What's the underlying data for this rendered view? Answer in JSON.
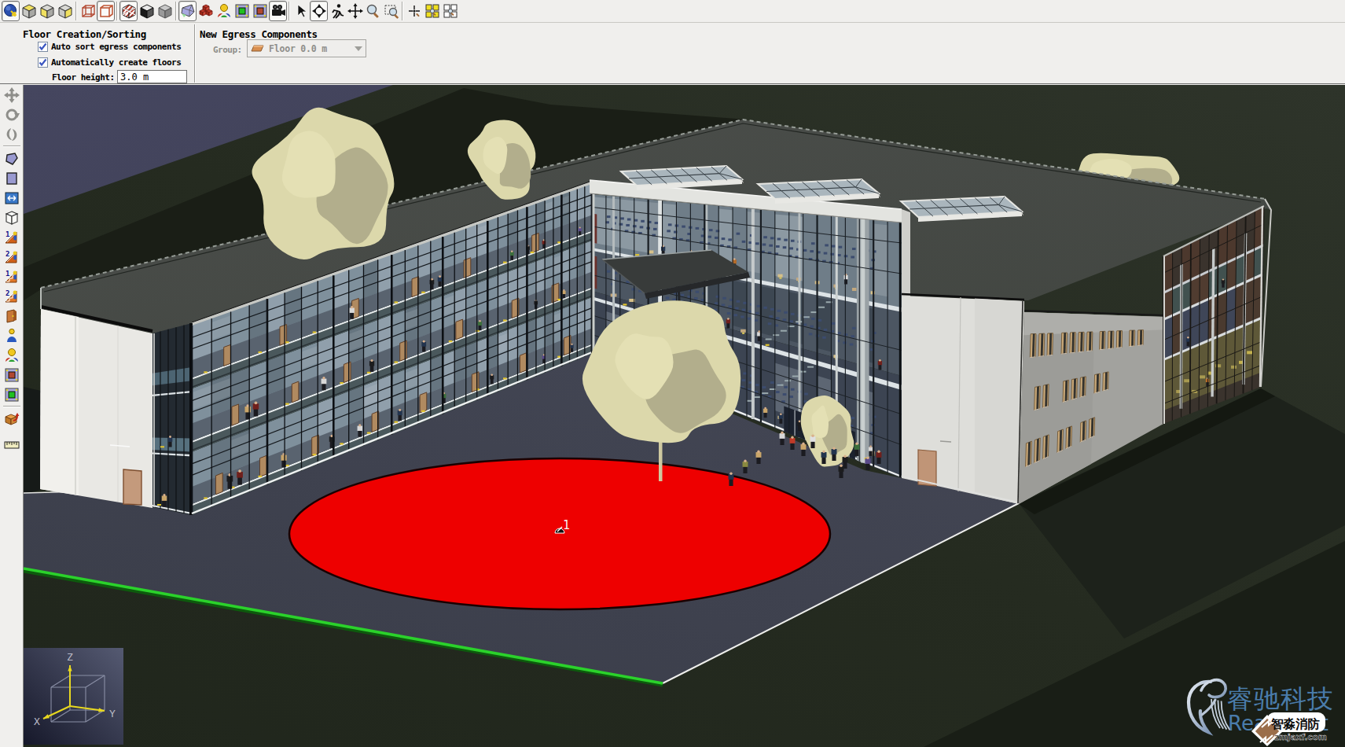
{
  "toolbar": {
    "buttons": [
      {
        "name": "select-objects",
        "icon": "sphere-select",
        "pressed": true
      },
      {
        "name": "select-faces-top",
        "icon": "cube-top",
        "pressed": false
      },
      {
        "name": "select-faces-side",
        "icon": "cube-side",
        "pressed": false
      },
      {
        "name": "select-faces-front",
        "icon": "cube-front",
        "pressed": false
      },
      {
        "name": "sep"
      },
      {
        "name": "wireframe-view",
        "icon": "wire-cube",
        "pressed": false
      },
      {
        "name": "wireframe-shaded-view",
        "icon": "wire-cube2",
        "pressed": true
      },
      {
        "name": "sep"
      },
      {
        "name": "show-construction",
        "icon": "hatch-cube",
        "pressed": true
      },
      {
        "name": "show-solid",
        "icon": "dark-cube",
        "pressed": false
      },
      {
        "name": "show-gray",
        "icon": "gray-cube",
        "pressed": false
      },
      {
        "name": "sep"
      },
      {
        "name": "show-terrain",
        "icon": "terrain",
        "pressed": true
      },
      {
        "name": "show-obstructions",
        "icon": "red-boxes",
        "pressed": false
      },
      {
        "name": "show-occupants",
        "icon": "people",
        "pressed": false
      },
      {
        "name": "show-rooms",
        "icon": "room-green",
        "pressed": false
      },
      {
        "name": "show-doors",
        "icon": "room-red",
        "pressed": false
      },
      {
        "name": "show-cameras",
        "icon": "camera",
        "pressed": true
      },
      {
        "name": "sep"
      },
      {
        "name": "select-tool",
        "icon": "cursor",
        "pressed": false
      },
      {
        "name": "orbit-tool",
        "icon": "orbit",
        "pressed": true
      },
      {
        "name": "walk-tool",
        "icon": "runner",
        "pressed": false
      },
      {
        "name": "pan-tool",
        "icon": "move",
        "pressed": false
      },
      {
        "name": "zoom-tool",
        "icon": "zoom",
        "pressed": false
      },
      {
        "name": "zoom-box-tool",
        "icon": "zoom-box",
        "pressed": false
      },
      {
        "name": "sep"
      },
      {
        "name": "zoom-to-point",
        "icon": "zoom-point",
        "pressed": false
      },
      {
        "name": "reset-view",
        "icon": "fit-yellow",
        "pressed": false
      },
      {
        "name": "fit-view",
        "icon": "fit-white",
        "pressed": false
      }
    ]
  },
  "ribbon": {
    "floor_panel": {
      "title": "Floor Creation/Sorting",
      "checkbox_auto_sort": {
        "label": "Auto sort egress components",
        "checked": true
      },
      "checkbox_auto_create": {
        "label": "Automatically create floors",
        "checked": true
      },
      "floor_height_label": "Floor height:",
      "floor_height_value": "3.0 m"
    },
    "egress_panel": {
      "title": "New Egress Components",
      "group_label": "Group:",
      "group_value": "Floor 0.0 m"
    }
  },
  "side_toolbar": {
    "buttons": [
      {
        "name": "pan-view",
        "icon": "pan-gray",
        "disabled": true
      },
      {
        "name": "orbit-view",
        "icon": "orbit-gray",
        "disabled": true
      },
      {
        "name": "roam-view",
        "icon": "roam-gray",
        "disabled": true
      },
      {
        "name": "sep"
      },
      {
        "name": "draw-polygon",
        "icon": "poly-tool"
      },
      {
        "name": "draw-rectangle",
        "icon": "rect-tool"
      },
      {
        "name": "measure-tool",
        "icon": "measure"
      },
      {
        "name": "draw-box",
        "icon": "box-tool"
      },
      {
        "name": "one-way-stair",
        "icon": "stair1"
      },
      {
        "name": "two-way-stair",
        "icon": "stair2"
      },
      {
        "name": "one-way-escalator",
        "icon": "stair1b"
      },
      {
        "name": "two-way-escalator",
        "icon": "stair2b"
      },
      {
        "name": "add-door",
        "icon": "door"
      },
      {
        "name": "add-occupant",
        "icon": "person"
      },
      {
        "name": "add-occupant-group",
        "icon": "people"
      },
      {
        "name": "add-room-door",
        "icon": "room-red"
      },
      {
        "name": "add-room",
        "icon": "room-green"
      },
      {
        "name": "sep"
      },
      {
        "name": "extract-floor",
        "icon": "extract"
      },
      {
        "name": "gap"
      },
      {
        "name": "measure-distance",
        "icon": "ruler"
      }
    ]
  },
  "viewport": {
    "marker_label": "1",
    "axis": {
      "x": "X",
      "y": "Y",
      "z": "Z"
    },
    "watermark": {
      "brand_cn": "睿驰科技",
      "brand_en": "Reachsoft",
      "badge_cn": "智淼消防",
      "badge_domain": "zmjaxf.com"
    },
    "colors": {
      "sky": "#3d3e55",
      "ground": "#262b21",
      "plaza": "#3e4150",
      "red_zone": "#ee0000",
      "green_line": "#2bd22b",
      "brand_blue": "#4a7cab"
    }
  }
}
